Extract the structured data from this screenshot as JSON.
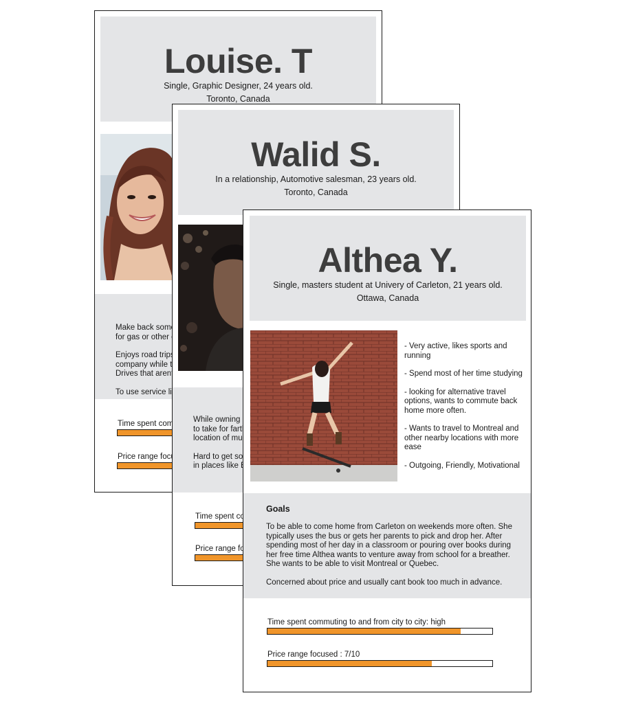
{
  "colors": {
    "panel_gray": "#e4e5e7",
    "accent_orange": "#f0952a",
    "border": "#1a1a1a"
  },
  "louise": {
    "name": "Louise. T",
    "subtitle_line1": "Single, Graphic Designer, 24 years old.",
    "subtitle_line2": "Toronto, Canada",
    "text_lines": [
      "Make back some",
      "for gas or other e",
      "Enjoys road trips",
      "company while ta",
      "Drives that arent",
      "To use service lik"
    ],
    "bar1_label": "Time spent comm",
    "bar2_label": "Price range focu"
  },
  "walid": {
    "name": "Walid S.",
    "subtitle_line1": "In a relationship, Automotive salesman, 23 years old.",
    "subtitle_line2": "Toronto, Canada",
    "text_lines": [
      "While owning a",
      "to take for farth",
      "location of mus",
      "Hard to get so",
      "in places like B"
    ],
    "bar1_label": "Time spent co",
    "bar2_label": "Price range fo"
  },
  "althea": {
    "name": "Althea Y.",
    "subtitle_line1": "Single, masters student at Univery of Carleton, 21 years old.",
    "subtitle_line2": "Ottawa, Canada",
    "traits": [
      "- Very active, likes sports and running",
      "- Spend most of her time studying",
      "- looking for alternative travel options, wants to commute back home more often.",
      "- Wants to travel to Montreal and other nearby locations with more  ease",
      "- Outgoing, Friendly, Motivational"
    ],
    "goals_title": "Goals",
    "goals_paragraph1": "To be able to come home from Carleton on weekends more often. She typically uses the bus or gets her parents to pick and drop her. After spending most of her day in a classroom or pouring over books during her free time Althea wants to venture away from school for a breather. She wants to be able to visit Montreal or Quebec.",
    "goals_paragraph2": "Concerned about price and usually cant book too much in advance.",
    "bar1_label": "Time spent commuting to and from city to city: high",
    "bar1_fill_pct": 86,
    "bar2_label": "Price range focused : 7/10",
    "bar2_fill_pct": 73
  }
}
